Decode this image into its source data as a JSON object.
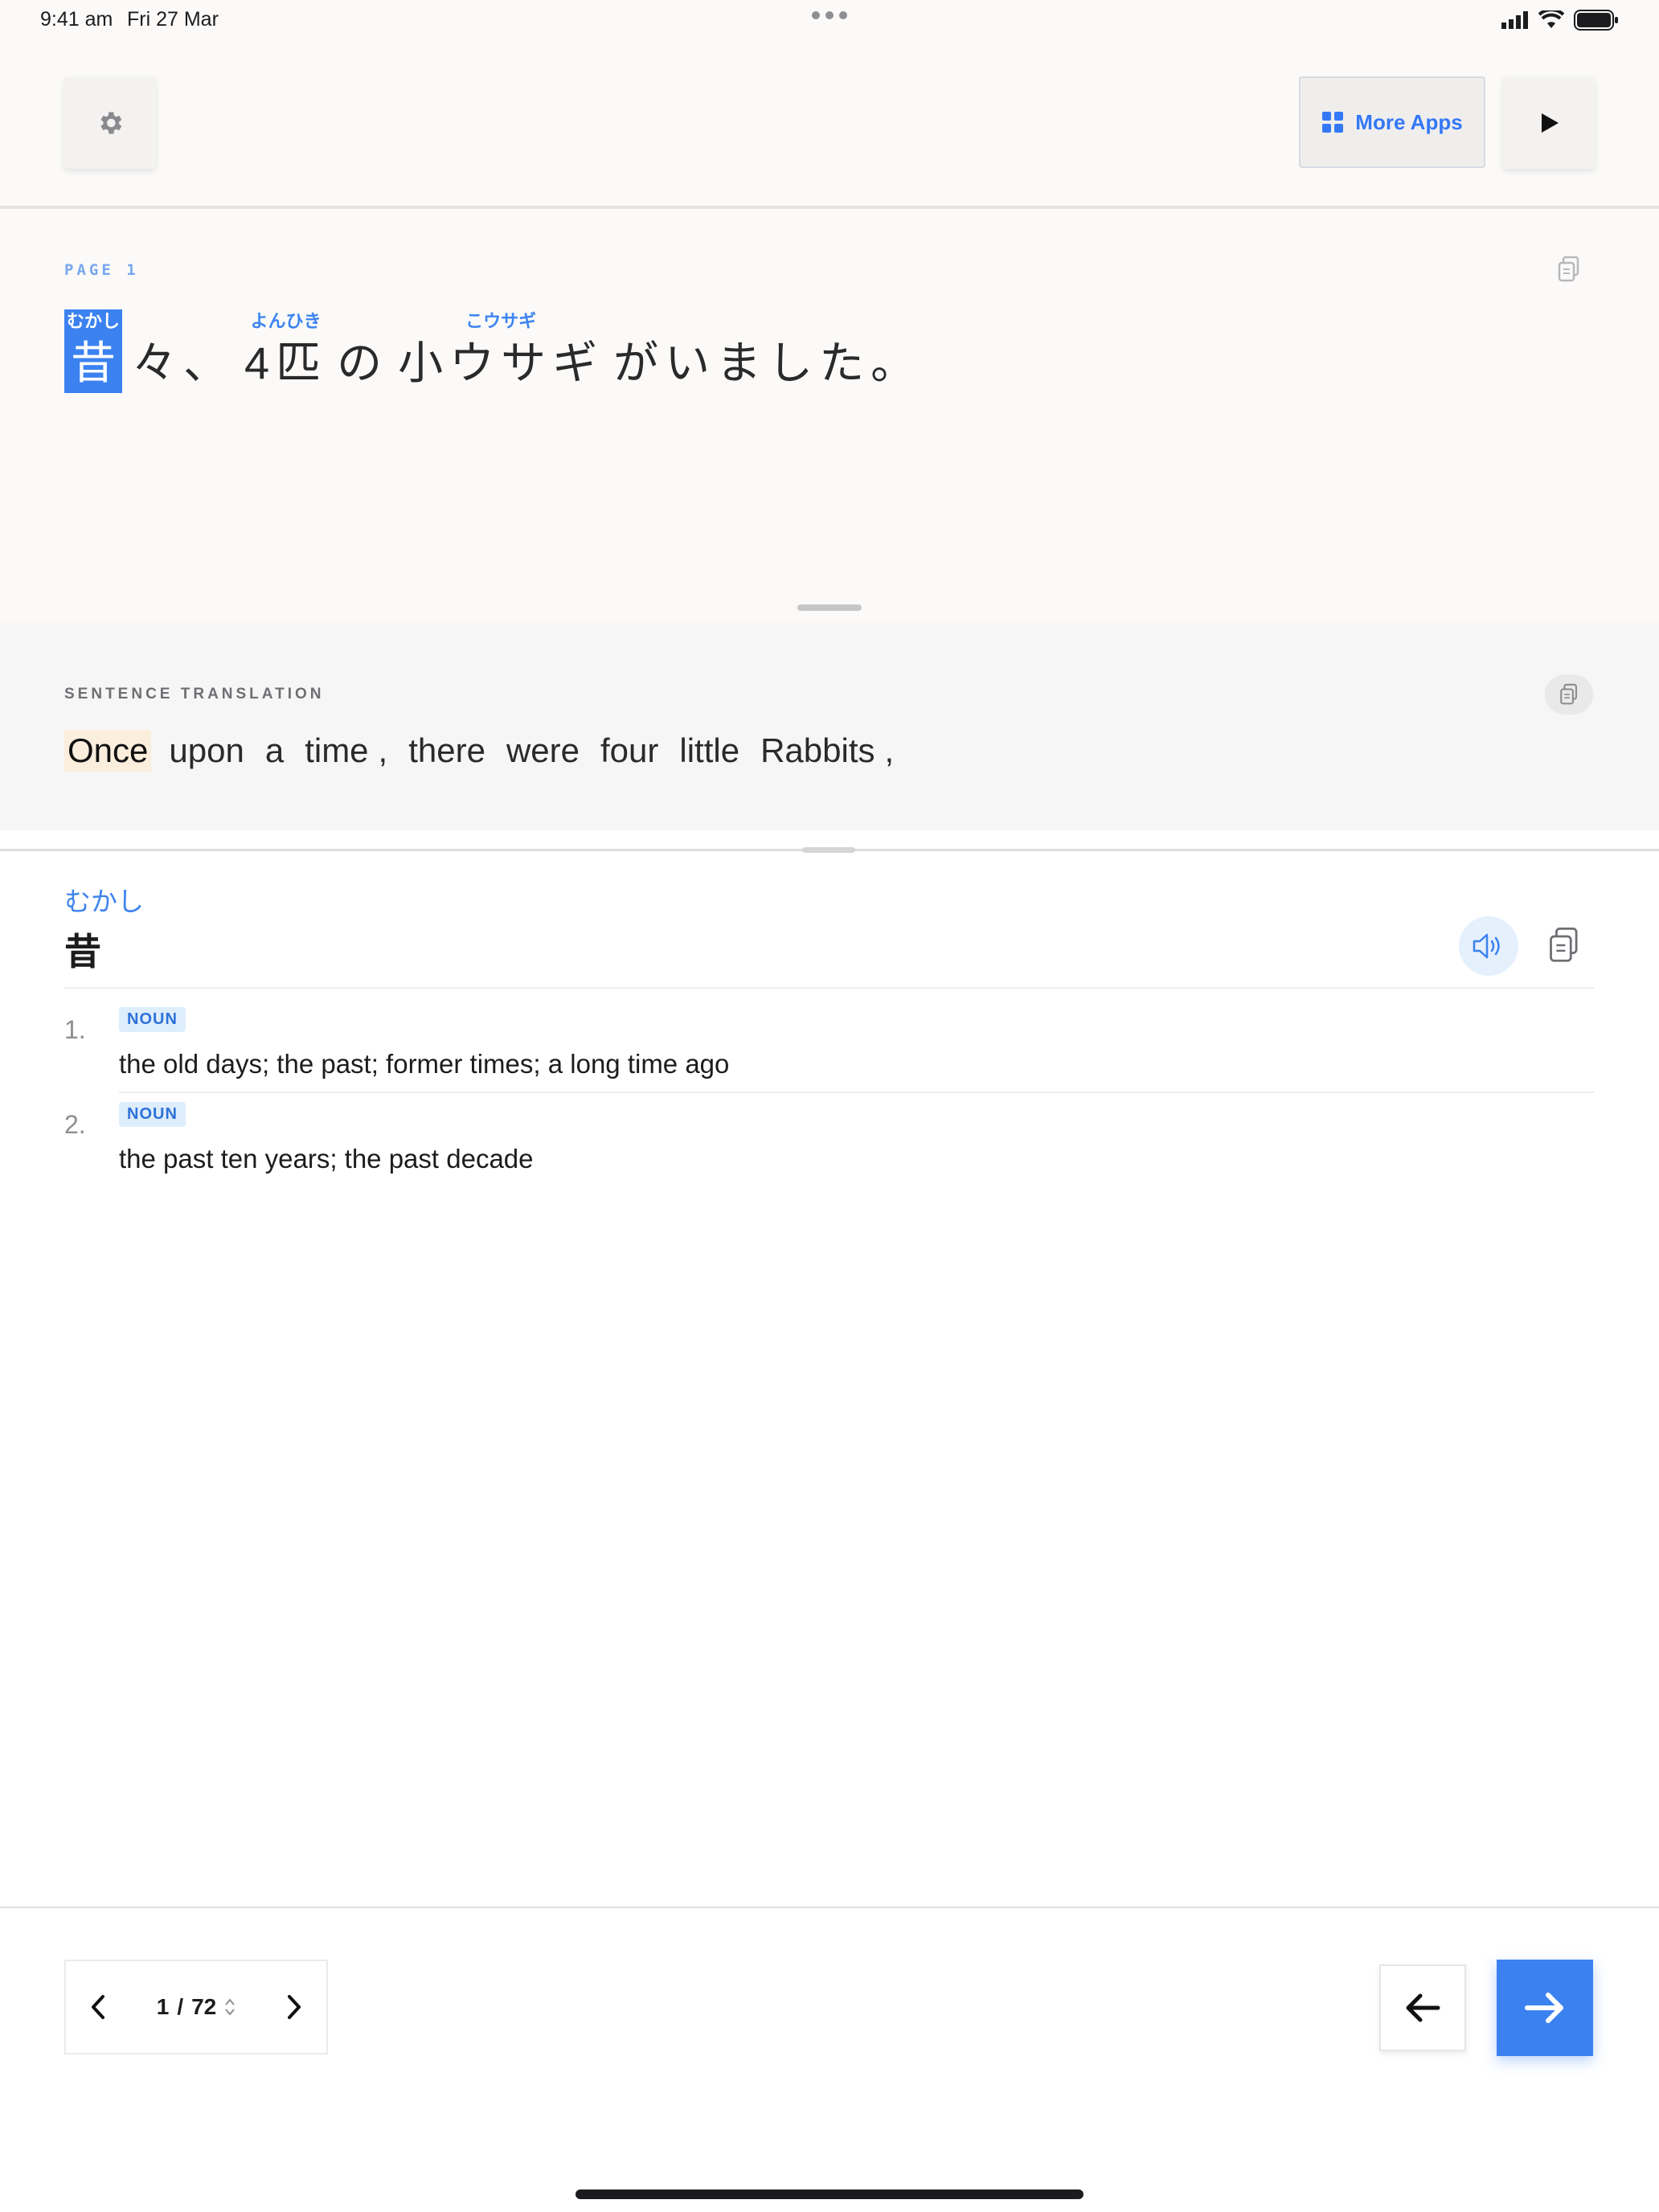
{
  "status_bar": {
    "time": "9:41 am",
    "date": "Fri 27 Mar"
  },
  "toolbar": {
    "settings_icon": "gear-icon",
    "more_apps_label": "More Apps",
    "more_apps_icon": "grid-icon",
    "play_icon": "play-icon"
  },
  "page": {
    "label": "PAGE 1",
    "tokens": [
      {
        "ruby": "むかし",
        "text": "昔",
        "selected": true
      },
      {
        "ruby": "",
        "text": "々、"
      },
      {
        "ruby": "よんひき",
        "text": "4匹"
      },
      {
        "ruby": "",
        "text": "の"
      },
      {
        "ruby": "こウサギ",
        "text": "小ウサギ"
      },
      {
        "ruby": "",
        "text": "がいました。"
      }
    ]
  },
  "translation": {
    "label": "SENTENCE TRANSLATION",
    "words": [
      "Once",
      "upon",
      "a",
      "time",
      ",",
      "there",
      "were",
      "four",
      "little",
      "Rabbits",
      ","
    ]
  },
  "dictionary": {
    "reading": "むかし",
    "headword": "昔",
    "senses": [
      {
        "num": "1.",
        "pos": "NOUN",
        "gloss": "the old days; the past; former times; a long time ago"
      },
      {
        "num": "2.",
        "pos": "NOUN",
        "gloss": "the past ten years; the past decade"
      }
    ]
  },
  "pager": {
    "current": "1",
    "sep": "/",
    "total": "72"
  },
  "colors": {
    "accent": "#3b82f0",
    "highlight": "#fbeedd"
  }
}
